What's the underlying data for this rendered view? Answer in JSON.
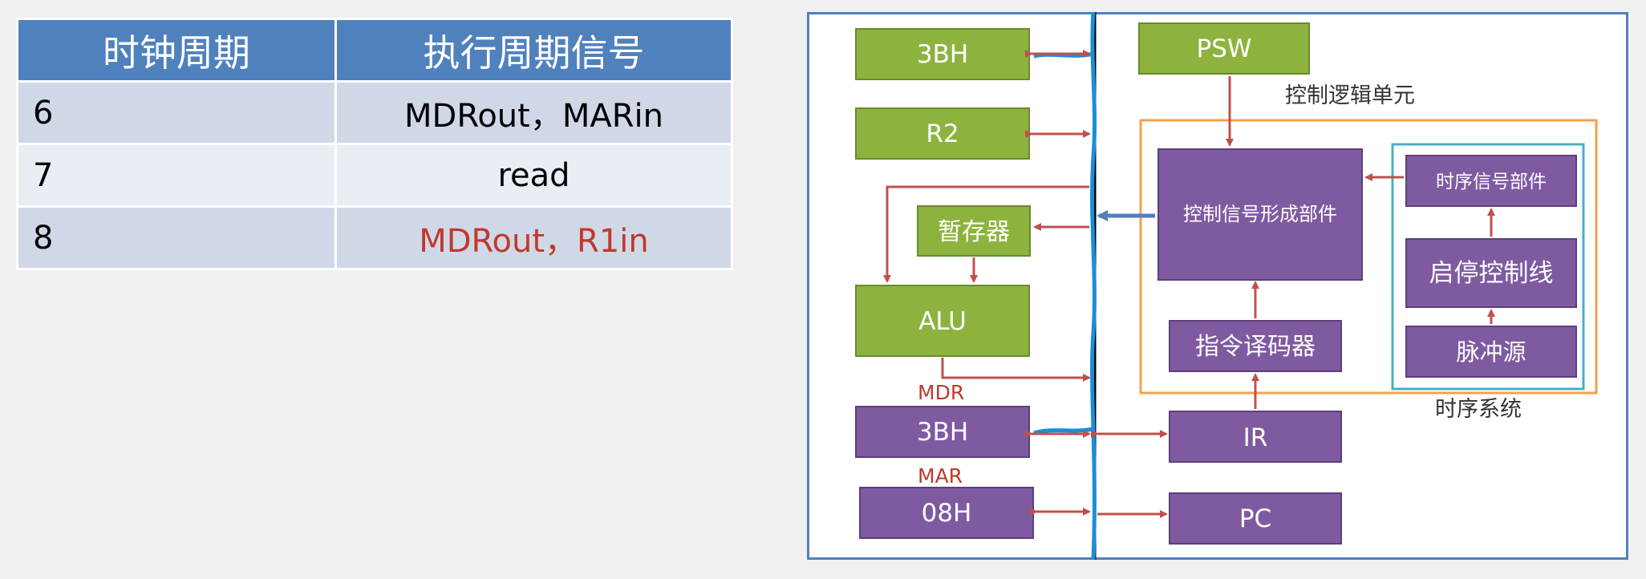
{
  "table": {
    "headers": [
      "时钟周期",
      "执行周期信号"
    ],
    "rows": [
      {
        "cycle": "6",
        "signal": "MDRout，MARin"
      },
      {
        "cycle": "7",
        "signal": "read"
      },
      {
        "cycle": "8",
        "signal": "MDRout，R1in"
      }
    ]
  },
  "diagram": {
    "left_boxes": {
      "reg_3bh": "3BH",
      "r2": "R2",
      "temp": "暂存器",
      "alu": "ALU",
      "mdr": "3BH",
      "mar": "08H"
    },
    "labels": {
      "mdr": "MDR",
      "mar": "MAR",
      "control_unit": "控制逻辑单元",
      "timing_system": "时序系统"
    },
    "right_boxes": {
      "psw": "PSW",
      "signal_former": "控制信号形成部件",
      "decoder": "指令译码器",
      "timing_signal": "时序信号部件",
      "start_stop": "启停控制线",
      "pulse": "脉冲源",
      "ir": "IR",
      "pc": "PC"
    }
  },
  "colors": {
    "header": "#4f81bd",
    "row_odd": "#d0d8e8",
    "row_even": "#e9edf4",
    "highlight_text": "#c0392b",
    "green_box": "#8db33e",
    "purple_box": "#7f5aa1",
    "arrow": "#c0504d",
    "bus": "#1a8fd8",
    "control_frame": "#f4a04a",
    "timing_frame": "#4bacc6"
  }
}
